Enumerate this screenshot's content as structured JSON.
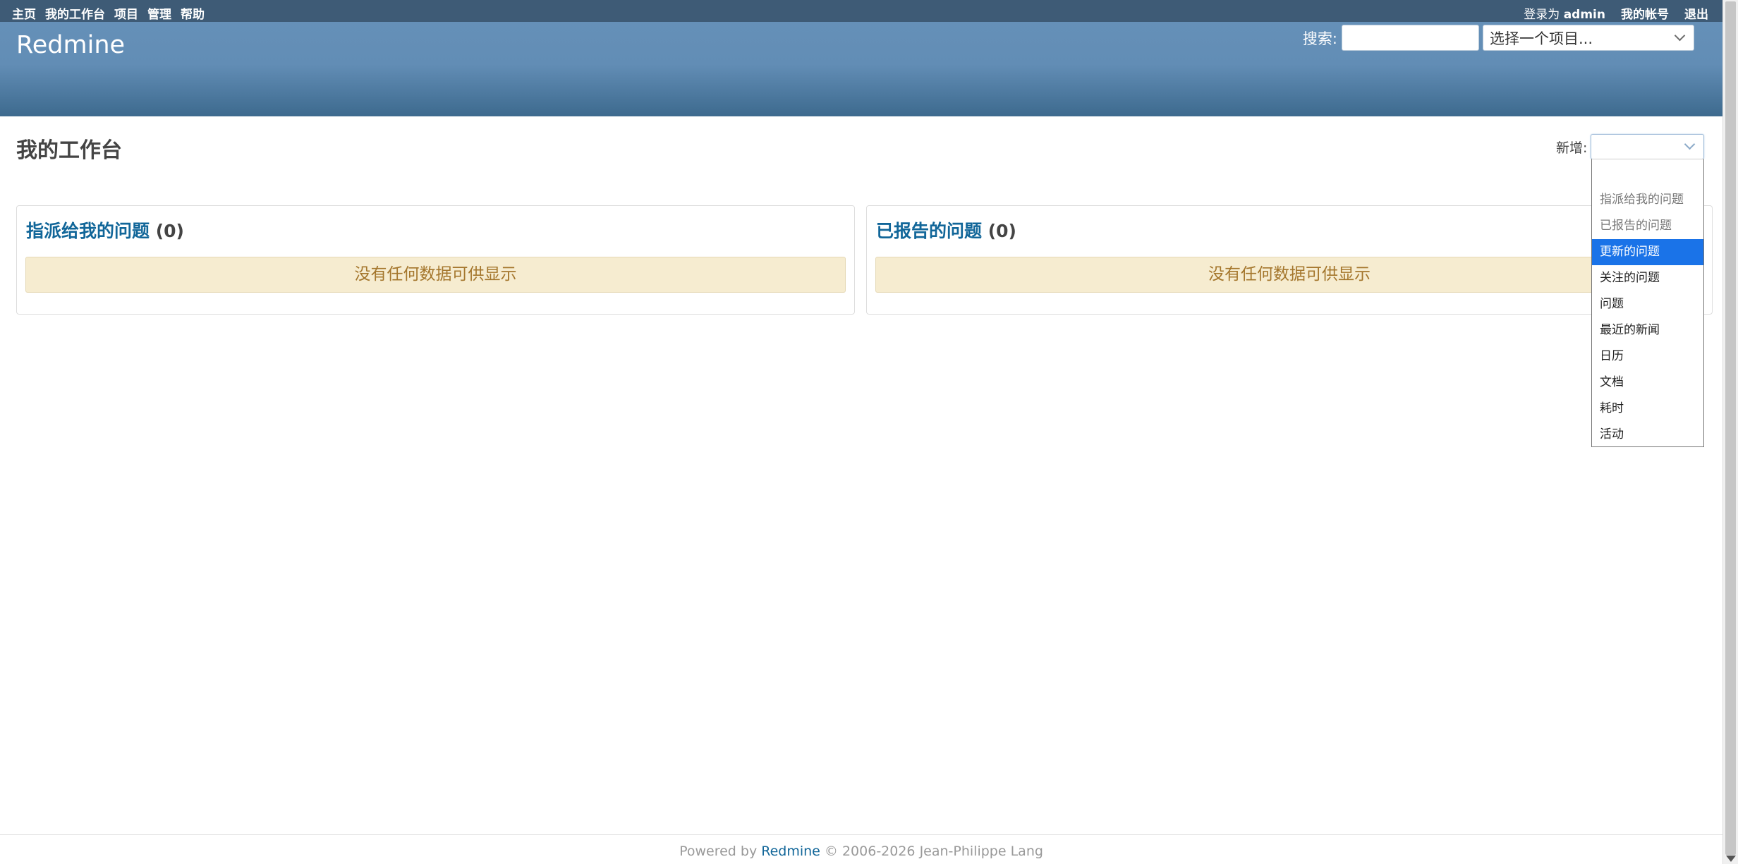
{
  "top_menu": {
    "items": [
      "主页",
      "我的工作台",
      "项目",
      "管理",
      "帮助"
    ],
    "logged_as_prefix": "登录为",
    "user": "admin",
    "my_account": "我的帐号",
    "logout": "退出"
  },
  "header": {
    "site_title": "Redmine",
    "search_label": "搜索:",
    "search_value": "",
    "project_jump": "选择一个项目..."
  },
  "main": {
    "page_title": "我的工作台",
    "add_label": "新增:",
    "add_selected": ""
  },
  "boxes": [
    {
      "title": "指派给我的问题",
      "count": "(0)",
      "nodata": "没有任何数据可供显示"
    },
    {
      "title": "已报告的问题",
      "count": "(0)",
      "nodata": "没有任何数据可供显示"
    }
  ],
  "dropdown": {
    "options": [
      {
        "label": "",
        "state": "blank"
      },
      {
        "label": "指派给我的问题",
        "state": "disabled"
      },
      {
        "label": "已报告的问题",
        "state": "disabled"
      },
      {
        "label": "更新的问题",
        "state": "selected"
      },
      {
        "label": "关注的问题",
        "state": "normal"
      },
      {
        "label": "问题",
        "state": "normal"
      },
      {
        "label": "最近的新闻",
        "state": "normal"
      },
      {
        "label": "日历",
        "state": "normal"
      },
      {
        "label": "文档",
        "state": "normal"
      },
      {
        "label": "耗时",
        "state": "normal"
      },
      {
        "label": "活动",
        "state": "normal"
      }
    ],
    "highlight_color": "#1a73e8"
  },
  "footer": {
    "prefix": "Powered by",
    "link": "Redmine",
    "suffix": "© 2006-2026 Jean-Philippe Lang"
  },
  "colors": {
    "top_menu_bg": "#3e5b76",
    "header_bg": "#628db5",
    "link": "#116699",
    "nodata_bg": "#f6ecd0",
    "nodata_text": "#a4762c"
  }
}
